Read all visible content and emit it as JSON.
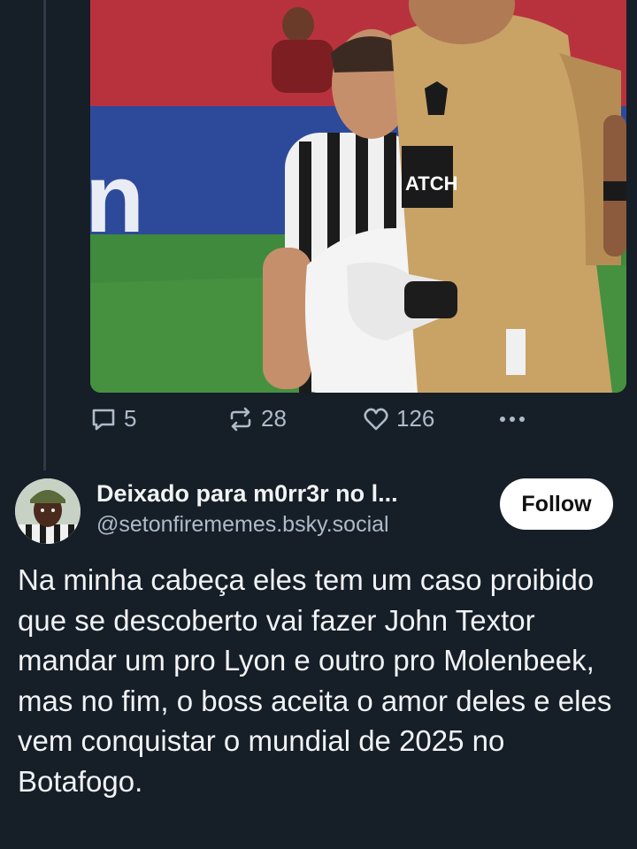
{
  "previous_post": {
    "media": {
      "description_icon": "photo-image"
    },
    "actions": {
      "reply_count": "5",
      "repost_count": "28",
      "like_count": "126",
      "reply_icon": "reply-icon",
      "repost_icon": "repost-icon",
      "like_icon": "heart-icon",
      "more_icon": "more-icon"
    }
  },
  "post": {
    "author_name": "Deixado para m0rr3r no l...",
    "handle": "@setonfirememes.bsky.social",
    "follow_label": "Follow",
    "text": "Na minha cabeça eles tem um caso proibido que se descoberto vai fazer John Textor mandar um pro Lyon e outro pro Molenbeek, mas no fim, o boss aceita o amor deles e eles vem conquistar o mundial de 2025 no Botafogo."
  },
  "colors": {
    "background": "#161e27",
    "text": "#f1f3f5",
    "muted": "#aebbc9",
    "button": "#ffffff"
  }
}
